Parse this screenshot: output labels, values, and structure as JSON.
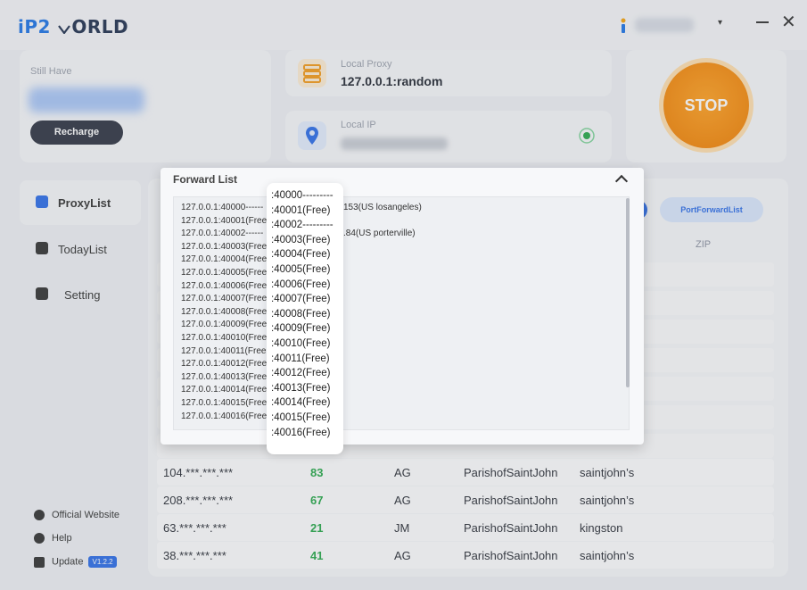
{
  "header": {
    "logo_left": "iP2",
    "logo_right": "ORLD",
    "user_menu_caret": "▾",
    "minimize": "—",
    "close": "✕"
  },
  "balance": {
    "label": "Still Have",
    "recharge_label": "Recharge"
  },
  "local_proxy": {
    "label": "Local Proxy",
    "value": "127.0.0.1:random"
  },
  "local_ip": {
    "label": "Local IP"
  },
  "stop_label": "STOP",
  "sidebar": {
    "items": [
      {
        "label": "ProxyList"
      },
      {
        "label": "TodayList"
      },
      {
        "label": "Setting"
      }
    ],
    "footer": {
      "website": "Official Website",
      "help": "Help",
      "update": "Update",
      "version": "V1.2.2"
    }
  },
  "main": {
    "tab_label": "PortForwardList",
    "zip_header": "ZIP",
    "rows": [
      {
        "ip": "104.***.***.***",
        "score": "83",
        "cc": "AG",
        "region": "ParishofSaintJohn",
        "city": "saintjohn’s"
      },
      {
        "ip": "208.***.***.***",
        "score": "67",
        "cc": "AG",
        "region": "ParishofSaintJohn",
        "city": "saintjohn’s"
      },
      {
        "ip": "63.***.***.***",
        "score": "21",
        "cc": "JM",
        "region": "ParishofSaintJohn",
        "city": "kingston"
      },
      {
        "ip": "38.***.***.***",
        "score": "41",
        "cc": "AG",
        "region": "ParishofSaintJohn",
        "city": "saintjohn’s"
      }
    ]
  },
  "forward_list": {
    "title": "Forward List",
    "rows": [
      "127.0.0.1:40000------",
      "127.0.0.1:40001(Free",
      "127.0.0.1:40002------",
      "127.0.0.1:40003(Free",
      "127.0.0.1:40004(Free",
      "127.0.0.1:40005(Free",
      "127.0.0.1:40006(Free",
      "127.0.0.1:40007(Free",
      "127.0.0.1:40008(Free",
      "127.0.0.1:40009(Free",
      "127.0.0.1:40010(Free",
      "127.0.0.1:40011(Free",
      "127.0.0.1:40012(Free",
      "127.0.0.1:40013(Free",
      "127.0.0.1:40014(Free",
      "127.0.0.1:40015(Free",
      "127.0.0.1:40016(Free"
    ],
    "right_texts": [
      "153(US losangeles)",
      ".84(US porterville)"
    ]
  },
  "popup": {
    "items": [
      ":40000---------",
      ":40001(Free)",
      ":40002---------",
      ":40003(Free)",
      ":40004(Free)",
      ":40005(Free)",
      ":40006(Free)",
      ":40007(Free)",
      ":40008(Free)",
      ":40009(Free)",
      ":40010(Free)",
      ":40011(Free)",
      ":40012(Free)",
      ":40013(Free)",
      ":40014(Free)",
      ":40015(Free)",
      ":40016(Free)"
    ]
  },
  "colors": {
    "accent_blue": "#2d6de8",
    "stop_orange": "#f58a0b",
    "score_green": "#27a84a",
    "dark_button": "#2f3442"
  }
}
